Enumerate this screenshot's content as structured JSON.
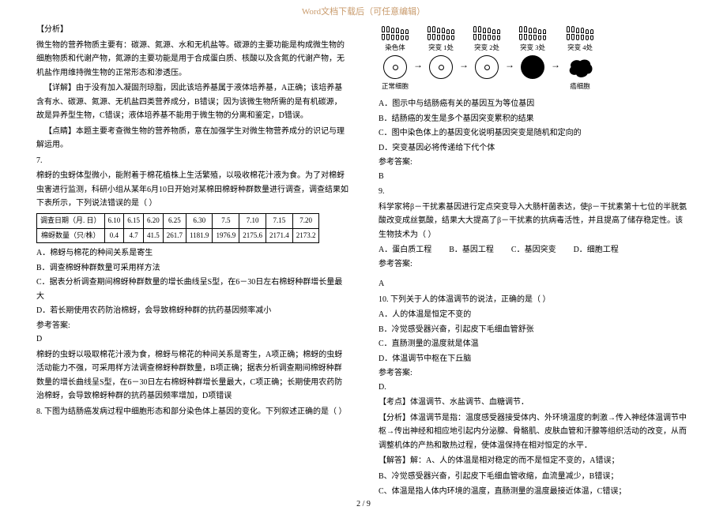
{
  "header": "Word文档下载后（可任意编辑）",
  "footer": "2 / 9",
  "left": {
    "h_analysis": "【分析】",
    "analysis_p1": "微生物的营养物质主要有：碳源、氮源、水和无机盐等。碳源的主要功能是构成微生物的细胞物质和代谢产物，氮源的主要功能是用于合成蛋白质、核酸以及含氮的代谢产物，无机盐作用维持微生物的正常形态和渗透压。",
    "h_detail": "【详解】由于没有加入凝固剂琼脂，因此该培养基属于液体培养基，A正确；该培养基含有水、碳源、氮源、无机盐四类营养成分，B错误；因为该微生物所需的是有机碳源，故是异养型生物，C错误；液体培养基不能用于微生物的分离和鉴定，D错误。",
    "h_point": "【点睛】本题主要考查微生物的营养物质，意在加强学生对微生物营养成分的识记与理解运用。",
    "q7_num": "7.",
    "q7_body": "棉蚜的虫蚜体型微小，能附着于棉花植株上生活繁殖，以吸收棉花汁液为食。为了对棉蚜虫害进行监测，科研小组从某年6月10日开始对某棉田棉蚜种群数量进行调查，调查结果如下表所示，下列说法错误的是（    ）",
    "q7_table": {
      "row0_label": "调查日期（月. 日）",
      "row1_label": "棉蚜数量（只/株）",
      "dates": [
        "6.10",
        "6.15",
        "6.20",
        "6.25",
        "6.30",
        "7.5",
        "7.10",
        "7.15",
        "7.20"
      ],
      "vals": [
        "0.4",
        "4.7",
        "41.5",
        "261.7",
        "1181.9",
        "1976.9",
        "2175.6",
        "2171.4",
        "2173.2"
      ]
    },
    "q7_opts": {
      "A": "A．棉蚜与棉花的种间关系是寄生",
      "B": "B．调查棉蚜种群数量可采用样方法",
      "C": "C．据表分析调查期间棉蚜种群数量的增长曲线呈S型，在6－30日左右棉蚜种群增长量最大",
      "D": "D．若长期使用农药防治棉蚜，会导致棉蚜种群的抗药基因频率减小"
    },
    "q7_ans_label": "参考答案:",
    "q7_ans": "D",
    "q7_exp": "棉蚜的虫蚜以吸取棉花汁液为食，棉蚜与棉花的种间关系是寄生，A项正确；棉蚜的虫蚜活动能力不强，可采用样方法调查棉蚜种群数量，B项正确；据表分析调查期间棉蚜种群数量的增长曲线呈S型，在6－30日左右棉蚜种群增长量最大，C项正确；长期使用农药防治棉蚜，会导致棉蚜种群的抗药基因频率增加，D项错误",
    "q8_lead": "8. 下图为结肠癌发病过程中细胞形态和部分染色体上基因的变化。下列叙述正确的是（    ）"
  },
  "right": {
    "fig_labels": {
      "chrom": "染色体",
      "m1": "突变 1处",
      "m2": "突变 2处",
      "m3": "突变 3处",
      "m4": "突变 4处",
      "normal": "正常细胞",
      "cancer": "癌细胞"
    },
    "q8_opts": {
      "A": "A．图示中与结肠癌有关的基因互为等位基因",
      "B": "B．结肠癌的发生是多个基因突变累积的结果",
      "C": "C．图中染色体上的基因变化说明基因突变是随机和定向的",
      "D": "D．突变基因必将传递给下代个体"
    },
    "q8_ans_label": "参考答案:",
    "q8_ans": "B",
    "q9_num": "9.",
    "q9_body": "科学家将β－干扰素基因进行定点突变导入大肠杆菌表达，使β－干扰素第十七位的半胱氨酸改变成丝氨酸，结果大大提高了β－干扰素的抗病毒活性，并且提高了储存稳定性。该生物技术为（    ）",
    "q9_opts": {
      "A": "A．蛋白质工程",
      "B": "B．基因工程",
      "C": "C．基因突变",
      "D": "D．细胞工程"
    },
    "q9_ans_label": "参考答案:",
    "q9_ans": "A",
    "q10": "10. 下列关于人的体温调节的说法，正确的是（    ）",
    "q10_opts": {
      "A": "A．人的体温是恒定不变的",
      "B": "B．冷觉感受器兴奋，引起皮下毛细血管舒张",
      "C": "C．直肠测量的温度就是体温",
      "D": "D．体温调节中枢在下丘脑"
    },
    "q10_ans_label": "参考答案:",
    "q10_ans": "D.",
    "q10_point": "【考点】体温调节、水盐调节、血糖调节．",
    "q10_analysis": "【分析】体温调节是指：温度感受器接受体内、外环境温度的刺激→传入神经体温调节中枢→传出神经和相应地引起内分泌腺、骨骼肌、皮肤血管和汗腺等组织活动的改变，从而调整机体的产热和散热过程，使体温保持在相对恒定的水平．",
    "q10_exp_label": "【解答】解：",
    "q10_exp_A": "A、人的体温是相对稳定的而不是恒定不变的，A错误；",
    "q10_exp_B": "B、冷觉感受器兴奋，引起皮下毛细血管收缩，血流量减少，B错误；",
    "q10_exp_C": "C、体温是指人体内环境的温度，直肠测量的温度最接近体温，C错误；"
  }
}
